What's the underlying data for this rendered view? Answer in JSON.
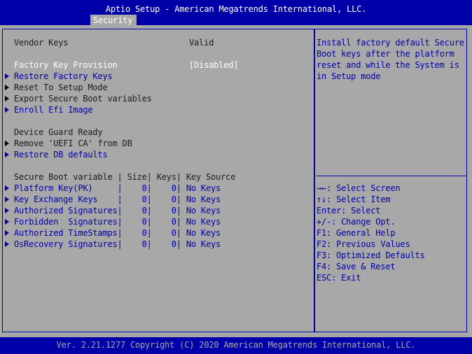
{
  "header": {
    "title": "Aptio Setup - American Megatrends International, LLC.",
    "tab": "Security"
  },
  "main": {
    "vendor_keys": {
      "label": "Vendor Keys",
      "value": "Valid"
    },
    "factory_key_provision": {
      "label": "Factory Key Provision",
      "value": "[Disabled]"
    },
    "restore_factory_keys": "Restore Factory Keys",
    "reset_to_setup_mode": "Reset To Setup Mode",
    "export_secure_boot_variables": "Export Secure Boot variables",
    "enroll_efi_image": "Enroll Efi Image",
    "device_guard_ready": "Device Guard Ready",
    "remove_uefi_ca": "Remove 'UEFI CA' from DB",
    "restore_db_defaults": "Restore DB defaults",
    "table_header": "Secure Boot variable | Size| Keys| Key Source",
    "rows": [
      "Platform Key(PK)     |    0|    0| No Keys",
      "Key Exchange Keys    |    0|    0| No Keys",
      "Authorized Signatures|    0|    0| No Keys",
      "Forbidden  Signatures|    0|    0| No Keys",
      "Authorized TimeStamps|    0|    0| No Keys",
      "OsRecovery Signatures|    0|    0| No Keys"
    ]
  },
  "help": {
    "description": [
      "Install factory default Secure",
      "Boot keys after the platform",
      "reset and while the System is",
      "in Setup mode"
    ],
    "keys": [
      "→←: Select Screen",
      "↑↓: Select Item",
      "Enter: Select",
      "+/-: Change Opt.",
      "F1: General Help",
      "F2: Previous Values",
      "F3: Optimized Defaults",
      "F4: Save & Reset",
      "ESC: Exit"
    ]
  },
  "footer": {
    "version": "Ver. 2.21.1277 Copyright (C) 2020 American Megatrends International, LLC."
  },
  "colors": {
    "header_bg": "#0000a8",
    "panel_bg": "#a8a8a8",
    "link": "#0000a8",
    "highlight": "#ffffff",
    "static_text": "#1c1c1c"
  }
}
